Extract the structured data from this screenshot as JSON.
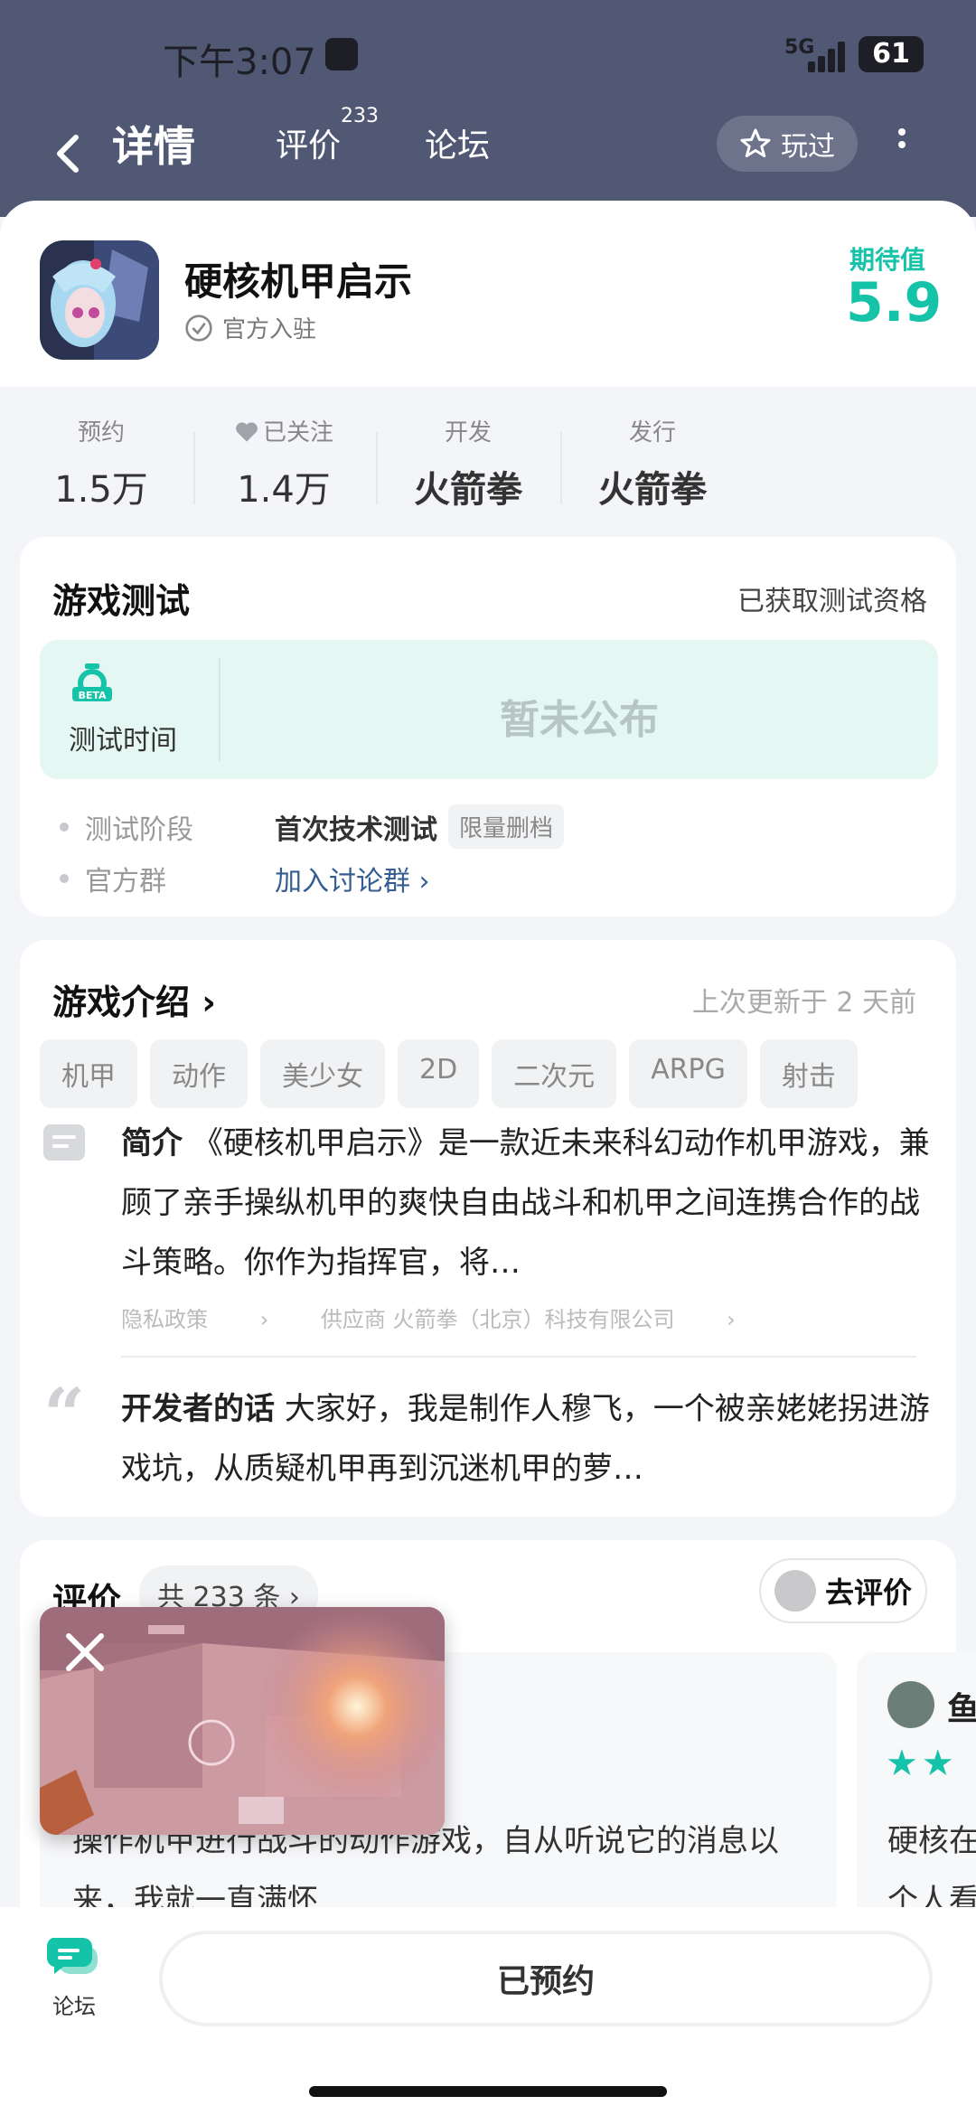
{
  "status_bar": {
    "time": "下午3:07",
    "network": "5G",
    "battery": "61"
  },
  "nav": {
    "tabs": [
      {
        "label": "详情",
        "active": true
      },
      {
        "label": "评价",
        "count": "233"
      },
      {
        "label": "论坛"
      }
    ],
    "played_label": "玩过"
  },
  "game": {
    "title": "硬核机甲启示",
    "official_label": "官方入驻",
    "anticipation_label": "期待值",
    "anticipation_value": "5.9"
  },
  "stats": [
    {
      "label": "预约",
      "value": "1.5万"
    },
    {
      "label": "已关注",
      "value": "1.4万",
      "icon": "heart-icon"
    },
    {
      "label": "开发",
      "value": "火箭拳"
    },
    {
      "label": "发行",
      "value": "火箭拳"
    }
  ],
  "test": {
    "title": "游戏测试",
    "status": "已获取测试资格",
    "beta_badge": "BETA",
    "time_label": "测试时间",
    "time_value": "暂未公布",
    "stage_label": "测试阶段",
    "stage_value": "首次技术测试",
    "stage_tag": "限量删档",
    "group_label": "官方群",
    "group_link": "加入讨论群"
  },
  "intro": {
    "title": "游戏介绍",
    "updated": "上次更新于 2 天前",
    "tags": [
      "机甲",
      "动作",
      "美少女",
      "2D",
      "二次元",
      "ARPG",
      "射击"
    ],
    "brief_label": "简介",
    "brief_text": "《硬核机甲启示》是一款近未来科幻动作机甲游戏，兼顾了亲手操纵机甲的爽快自由战斗和机甲之间连携合作的战斗策略。你作为指挥官，将…",
    "privacy_link": "隐私政策",
    "supplier": "供应商 火箭拳（北京）科技有限公司",
    "dev_label": "开发者的话",
    "dev_text": "大家好，我是制作人穆飞，一个被亲姥姥拐进游戏坑，从质疑机甲再到沉迷机甲的萝…"
  },
  "reviews": {
    "title": "评价",
    "count_label": "共 233 条",
    "go_review": "去评价",
    "item1_text": "操作机甲进行战斗的动作游戏，自从听说它的消息以来，我就一直满怀",
    "item2_name": "鱼",
    "item2_text_1": "硬核在",
    "item2_text_2": "个人看"
  },
  "bottom": {
    "forum_label": "论坛",
    "reserve_label": "已预约"
  },
  "colors": {
    "accent": "#15c3a8",
    "header": "#515873"
  }
}
